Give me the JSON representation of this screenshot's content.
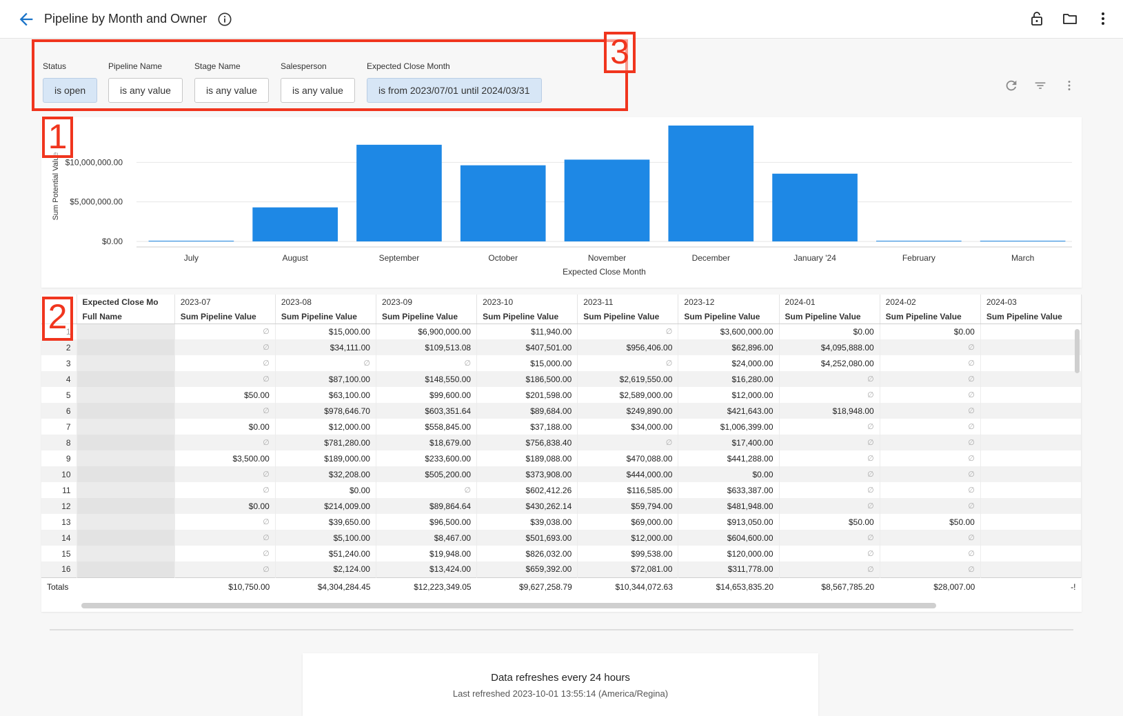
{
  "header": {
    "title": "Pipeline by Month and Owner"
  },
  "filters": [
    {
      "label": "Status",
      "value": "is open",
      "active": true
    },
    {
      "label": "Pipeline Name",
      "value": "is any value",
      "active": false
    },
    {
      "label": "Stage Name",
      "value": "is any value",
      "active": false
    },
    {
      "label": "Salesperson",
      "value": "is any value",
      "active": false
    },
    {
      "label": "Expected Close Month",
      "value": "is from 2023/07/01 until 2024/03/31",
      "active": true
    }
  ],
  "annotations": {
    "chart": "1",
    "table": "2",
    "filters": "3"
  },
  "colors": {
    "bar": "#1e88e5",
    "accent": "#1a73c8",
    "annotation": "#f0351e"
  },
  "chart_data": {
    "type": "bar",
    "categories": [
      "July",
      "August",
      "September",
      "October",
      "November",
      "December",
      "January '24",
      "February",
      "March"
    ],
    "values": [
      10750,
      4304284.45,
      12223349.05,
      9627258.79,
      10344072.63,
      14653835.2,
      8567785.2,
      28007,
      50000
    ],
    "xlabel": "Expected Close Month",
    "ylabel": "Sum Potential Value",
    "yticks": [
      "$0.00",
      "$5,000,000.00",
      "$10,000,000.00"
    ],
    "ylim": [
      0,
      14653835.2
    ]
  },
  "table": {
    "pivot_label": "Expected Close Mo",
    "row_label": "Full Name",
    "columns": [
      "2023-07",
      "2023-08",
      "2023-09",
      "2023-10",
      "2023-11",
      "2023-12",
      "2024-01",
      "2024-02",
      "2024-03"
    ],
    "measure": "Sum Pipeline Value",
    "rows": [
      [
        "1",
        "∅",
        "$15,000.00",
        "$6,900,000.00",
        "$11,940.00",
        "∅",
        "$3,600,000.00",
        "$0.00",
        "$0.00",
        ""
      ],
      [
        "2",
        "∅",
        "$34,111.00",
        "$109,513.08",
        "$407,501.00",
        "$956,406.00",
        "$62,896.00",
        "$4,095,888.00",
        "∅",
        ""
      ],
      [
        "3",
        "∅",
        "∅",
        "∅",
        "$15,000.00",
        "∅",
        "$24,000.00",
        "$4,252,080.00",
        "∅",
        ""
      ],
      [
        "4",
        "∅",
        "$87,100.00",
        "$148,550.00",
        "$186,500.00",
        "$2,619,550.00",
        "$16,280.00",
        "∅",
        "∅",
        ""
      ],
      [
        "5",
        "$50.00",
        "$63,100.00",
        "$99,600.00",
        "$201,598.00",
        "$2,589,000.00",
        "$12,000.00",
        "∅",
        "∅",
        ""
      ],
      [
        "6",
        "∅",
        "$978,646.70",
        "$603,351.64",
        "$89,684.00",
        "$249,890.00",
        "$421,643.00",
        "$18,948.00",
        "∅",
        ""
      ],
      [
        "7",
        "$0.00",
        "$12,000.00",
        "$558,845.00",
        "$37,188.00",
        "$34,000.00",
        "$1,006,399.00",
        "∅",
        "∅",
        ""
      ],
      [
        "8",
        "∅",
        "$781,280.00",
        "$18,679.00",
        "$756,838.40",
        "∅",
        "$17,400.00",
        "∅",
        "∅",
        ""
      ],
      [
        "9",
        "$3,500.00",
        "$189,000.00",
        "$233,600.00",
        "$189,088.00",
        "$470,088.00",
        "$441,288.00",
        "∅",
        "∅",
        ""
      ],
      [
        "10",
        "∅",
        "$32,208.00",
        "$505,200.00",
        "$373,908.00",
        "$444,000.00",
        "$0.00",
        "∅",
        "∅",
        ""
      ],
      [
        "11",
        "∅",
        "$0.00",
        "∅",
        "$602,412.26",
        "$116,585.00",
        "$633,387.00",
        "∅",
        "∅",
        ""
      ],
      [
        "12",
        "$0.00",
        "$214,009.00",
        "$89,864.64",
        "$430,262.14",
        "$59,794.00",
        "$481,948.00",
        "∅",
        "∅",
        ""
      ],
      [
        "13",
        "∅",
        "$39,650.00",
        "$96,500.00",
        "$39,038.00",
        "$69,000.00",
        "$913,050.00",
        "$50.00",
        "$50.00",
        ""
      ],
      [
        "14",
        "∅",
        "$5,100.00",
        "$8,467.00",
        "$501,693.00",
        "$12,000.00",
        "$604,600.00",
        "∅",
        "∅",
        ""
      ],
      [
        "15",
        "∅",
        "$51,240.00",
        "$19,948.00",
        "$826,032.00",
        "$99,538.00",
        "$120,000.00",
        "∅",
        "∅",
        ""
      ],
      [
        "16",
        "∅",
        "$2,124.00",
        "$13,424.00",
        "$659,392.00",
        "$72,081.00",
        "$311,778.00",
        "∅",
        "∅",
        ""
      ]
    ],
    "totals_label": "Totals",
    "totals": [
      "$10,750.00",
      "$4,304,284.45",
      "$12,223,349.05",
      "$9,627,258.79",
      "$10,344,072.63",
      "$14,653,835.20",
      "$8,567,785.20",
      "$28,007.00",
      "-!"
    ]
  },
  "footer": {
    "refresh_title": "Data refreshes every 24 hours",
    "last_refreshed": "Last refreshed 2023-10-01 13:55:14 (America/Regina)"
  }
}
